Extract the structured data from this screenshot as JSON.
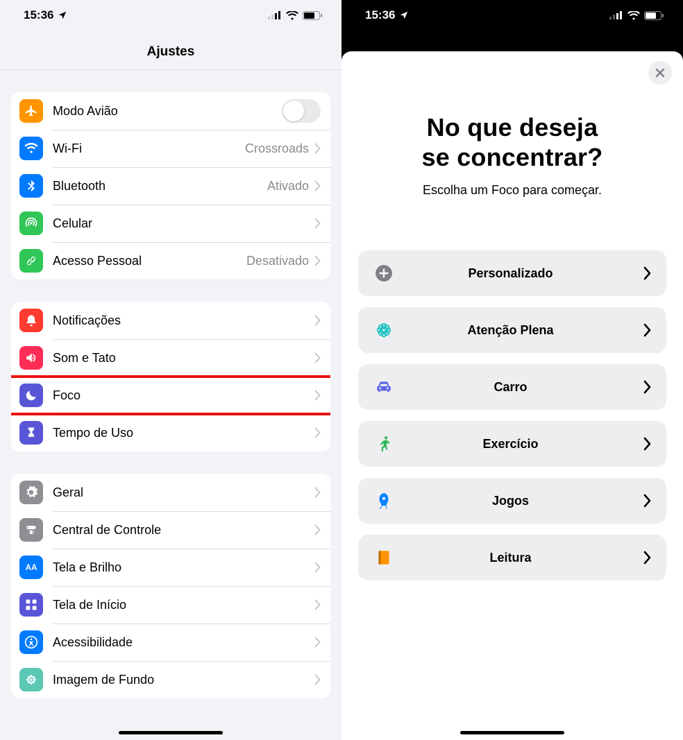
{
  "status": {
    "time": "15:36"
  },
  "left": {
    "title": "Ajustes",
    "groups": [
      {
        "rows": [
          {
            "icon": "airplane",
            "bg": "bg-orange",
            "label": "Modo Avião",
            "control": "toggle"
          },
          {
            "icon": "wifi",
            "bg": "bg-blue",
            "label": "Wi-Fi",
            "value": "Crossroads",
            "chevron": true
          },
          {
            "icon": "bluetooth",
            "bg": "bg-blue",
            "label": "Bluetooth",
            "value": "Ativado",
            "chevron": true
          },
          {
            "icon": "antenna",
            "bg": "bg-green",
            "label": "Celular",
            "chevron": true
          },
          {
            "icon": "link",
            "bg": "bg-green2",
            "label": "Acesso Pessoal",
            "value": "Desativado",
            "chevron": true
          }
        ]
      },
      {
        "rows": [
          {
            "icon": "bell",
            "bg": "bg-red",
            "label": "Notificações",
            "chevron": true
          },
          {
            "icon": "speaker",
            "bg": "bg-pink",
            "label": "Som e Tato",
            "chevron": true
          },
          {
            "icon": "moon",
            "bg": "bg-indigo",
            "label": "Foco",
            "chevron": true,
            "highlight": true
          },
          {
            "icon": "hourglass",
            "bg": "bg-indigo",
            "label": "Tempo de Uso",
            "chevron": true
          }
        ]
      },
      {
        "rows": [
          {
            "icon": "gear",
            "bg": "bg-gray",
            "label": "Geral",
            "chevron": true
          },
          {
            "icon": "switches",
            "bg": "bg-gray",
            "label": "Central de Controle",
            "chevron": true
          },
          {
            "icon": "aa",
            "bg": "bg-lblue",
            "label": "Tela e Brilho",
            "chevron": true
          },
          {
            "icon": "grid",
            "bg": "bg-indigo",
            "label": "Tela de Início",
            "chevron": true
          },
          {
            "icon": "access",
            "bg": "bg-lblue",
            "label": "Acessibilidade",
            "chevron": true
          },
          {
            "icon": "flower",
            "bg": "bg-teal",
            "label": "Imagem de Fundo",
            "chevron": true
          }
        ]
      }
    ]
  },
  "right": {
    "title_line1": "No que deseja",
    "title_line2": "se concentrar?",
    "subtitle": "Escolha um Foco para começar.",
    "items": [
      {
        "icon": "plus",
        "color": "#7f7f85",
        "label": "Personalizado"
      },
      {
        "icon": "mindful",
        "color": "#21c3c3",
        "label": "Atenção Plena"
      },
      {
        "icon": "car",
        "color": "#5864e6",
        "label": "Carro"
      },
      {
        "icon": "runner",
        "color": "#2fb85a",
        "label": "Exercício"
      },
      {
        "icon": "rocket",
        "color": "#0a84ff",
        "label": "Jogos"
      },
      {
        "icon": "book",
        "color": "#ff9500",
        "label": "Leitura"
      }
    ]
  }
}
